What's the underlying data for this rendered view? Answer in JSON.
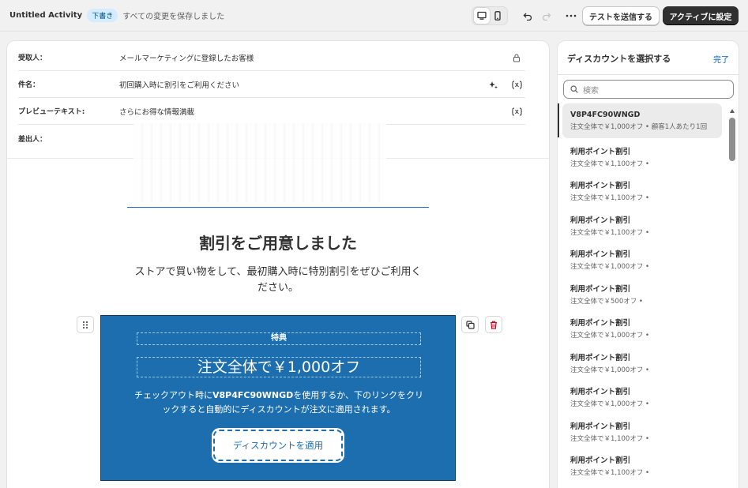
{
  "topbar": {
    "title": "Untitled Activity",
    "status_badge": "下書き",
    "save_status": "すべての変更を保存しました",
    "test_button": "テストを送信する",
    "activate_button": "アクティブに設定",
    "icons": [
      "desktop-icon",
      "mobile-icon",
      "undo-icon",
      "redo-icon",
      "more-icon"
    ]
  },
  "fields": {
    "recipient": {
      "label": "受取人：",
      "value": "メールマーケティングに登録したお客様"
    },
    "subject": {
      "label": "件名：",
      "value": "初回購入時に割引をご利用ください"
    },
    "preview": {
      "label": "プレビューテキスト:",
      "value": "さらにお得な情報満載"
    },
    "sender": {
      "label": "差出人：",
      "value": ""
    }
  },
  "email": {
    "heading": "割引をご用意しました",
    "subtext": "ストアで買い物をして、最初購入時に特別割引をぜひご利用ください。",
    "promo": {
      "label": "特典",
      "title": "注文全体で￥1,000オフ",
      "desc_prefix": "チェックアウト時に",
      "desc_code": "V8P4FC90WNGD",
      "desc_suffix": "を使用するか、下のリンクをクリックすると自動的にディスカウントが注文に適用されます。",
      "button": "ディスカウントを適用",
      "bg_color": "#1c6eae"
    }
  },
  "panel": {
    "title": "ディスカウントを選択する",
    "done": "完了",
    "search_placeholder": "検索",
    "items": [
      {
        "title": "V8P4FC90WNGD",
        "desc": "注文全体で￥1,000オフ • 顧客1人あたり1回"
      },
      {
        "title": "利用ポイント割引",
        "desc": "注文全体で￥1,100オフ •"
      },
      {
        "title": "利用ポイント割引",
        "desc": "注文全体で￥1,100オフ •"
      },
      {
        "title": "利用ポイント割引",
        "desc": "注文全体で￥1,100オフ •"
      },
      {
        "title": "利用ポイント割引",
        "desc": "注文全体で￥1,000オフ •"
      },
      {
        "title": "利用ポイント割引",
        "desc": "注文全体で￥500オフ •"
      },
      {
        "title": "利用ポイント割引",
        "desc": "注文全体で￥1,000オフ •"
      },
      {
        "title": "利用ポイント割引",
        "desc": "注文全体で￥1,000オフ •"
      },
      {
        "title": "利用ポイント割引",
        "desc": "注文全体で￥1,000オフ •"
      },
      {
        "title": "利用ポイント割引",
        "desc": "注文全体で￥1,100オフ •"
      },
      {
        "title": "利用ポイント割引",
        "desc": "注文全体で￥1,100オフ •"
      }
    ]
  }
}
